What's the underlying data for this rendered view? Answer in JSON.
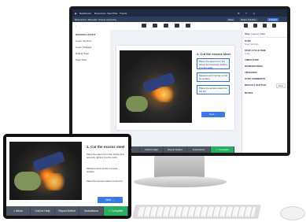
{
  "desktop": {
    "topbar": {
      "brand": "Dashboard",
      "nav": [
        "Resources",
        "View Plan",
        "Trends"
      ],
      "right_buttons": [
        "Save",
        "Share Solution",
        "Publish"
      ]
    },
    "breadcrumb": "Resources / Manuals / Frame Assembly",
    "left_panel": {
      "header": "MASTER LAYOUT",
      "items": [
        "Cover Sections",
        "Cover Package",
        "Drilling Steel",
        "Steel Tank"
      ]
    },
    "step": {
      "title": "1. Cut the excess steel",
      "instructions": [
        "Place the steel rod in the clamp and securely tighten it to the work.",
        "Measure and cut the rod at its surface.",
        "Place the excess steel into the bin."
      ],
      "next_label": "Next →"
    },
    "bottom_actions": [
      "< Menu",
      "Call for Help",
      "Report Defect",
      "Instructions",
      "✓ Complete"
    ],
    "right_panel": {
      "tabs": [
        "Step",
        "Layout",
        "Data"
      ],
      "sections": [
        {
          "label": "STEP",
          "value": "Step Settings"
        },
        {
          "label": "STEP CYCLE TIME",
          "value": "Total"
        },
        {
          "label": "TIMED STEP",
          "value": ""
        },
        {
          "label": "WAREHOUSING",
          "value": ""
        },
        {
          "label": "TRIGGERS",
          "value": ""
        },
        {
          "label": "STEP COMMENTS",
          "value": ""
        },
        {
          "label": "DEFAULT BUTTON",
          "value": "Next"
        },
        {
          "label": "NOTES",
          "value": ""
        }
      ]
    }
  },
  "tablet": {
    "step": {
      "title": "1. Cut the excess steel",
      "instructions": [
        "Place the steel rod in the clamp and securely tighten it to the work.",
        "Measure and cut the rod at its surface.",
        "Place the excess steel into the bin."
      ],
      "next_label": "Next →"
    },
    "bottom_actions": [
      "< Menu",
      "Call for Help",
      "Report Defect",
      "Instructions",
      "✓ Complete"
    ]
  }
}
